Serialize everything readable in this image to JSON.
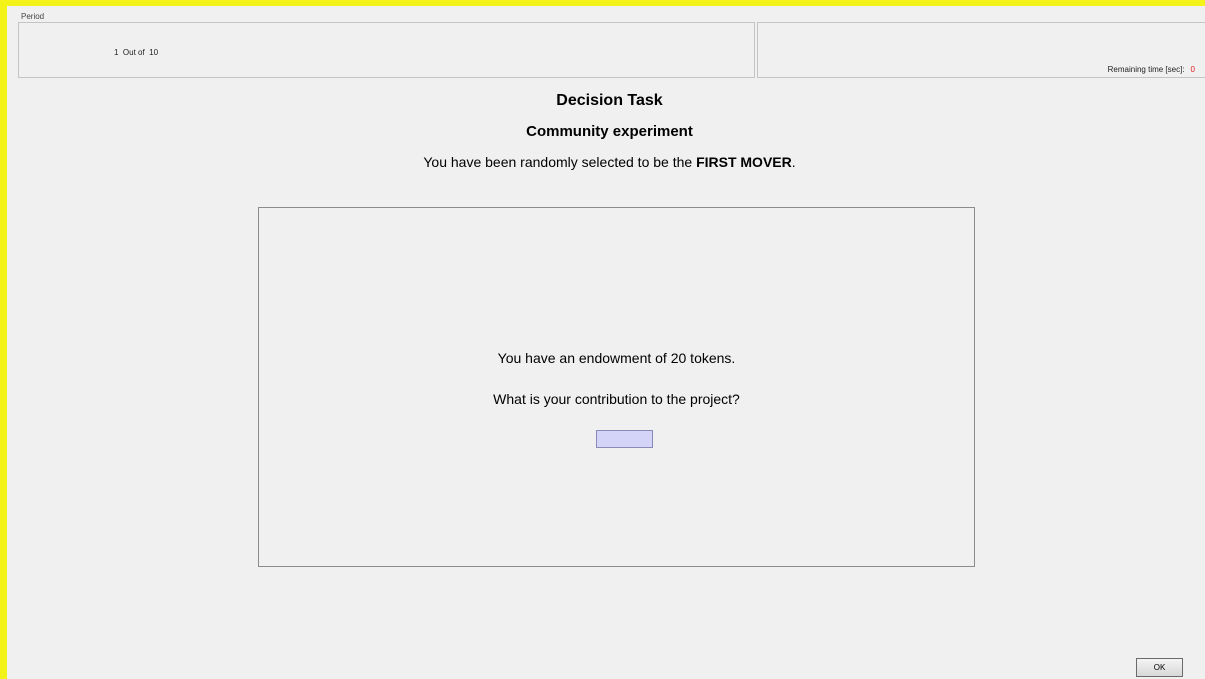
{
  "header": {
    "period_legend": "Period",
    "period_value": "1  Out of  10",
    "remaining_time_label": "Remaining time [sec]:",
    "remaining_time_value": "0"
  },
  "main": {
    "title": "Decision Task",
    "subtitle": "Community experiment",
    "selection_text_prefix": "You have been randomly selected to be the ",
    "selection_role": "FIRST MOVER",
    "selection_text_suffix": "."
  },
  "task": {
    "endowment_text": "You have an endowment of 20 tokens.",
    "question_text": "What is your contribution to the project?",
    "contribution_value": ""
  },
  "footer": {
    "ok_label": "OK"
  },
  "colors": {
    "frame_border": "#f3f31a",
    "background": "#f0f0f0",
    "input_fill": "#d4d4f8",
    "time_value": "#e02020"
  }
}
